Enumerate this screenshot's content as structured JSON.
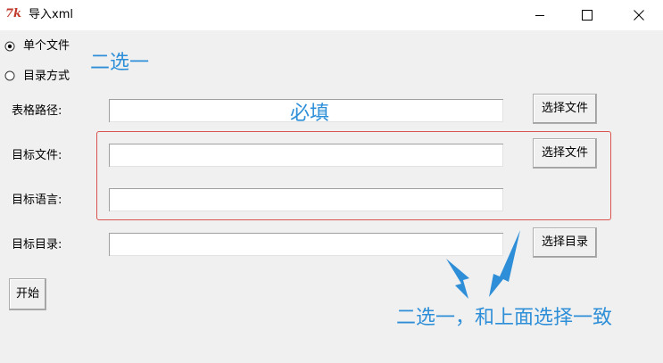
{
  "window": {
    "title": "导入xml",
    "icon": "tk-icon"
  },
  "mode": {
    "options": [
      {
        "label": "单个文件",
        "selected": true
      },
      {
        "label": "目录方式",
        "selected": false
      }
    ]
  },
  "form": {
    "table_path_label": "表格路径:",
    "target_file_label": "目标文件:",
    "target_language_label": "目标语言:",
    "target_dir_label": "目标目录:",
    "table_path_value": "",
    "target_file_value": "",
    "target_language_value": "",
    "target_dir_value": "",
    "browse_table_button": "选择文件",
    "browse_target_file_button": "选择文件",
    "browse_target_dir_button": "选择目录",
    "start_button": "开始"
  },
  "annotations": {
    "mode_note": "二选一",
    "required_note": "必填",
    "target_note": "二选一，和上面选择一致",
    "color": "#2e8fd8",
    "box_color": "#d9534f"
  }
}
